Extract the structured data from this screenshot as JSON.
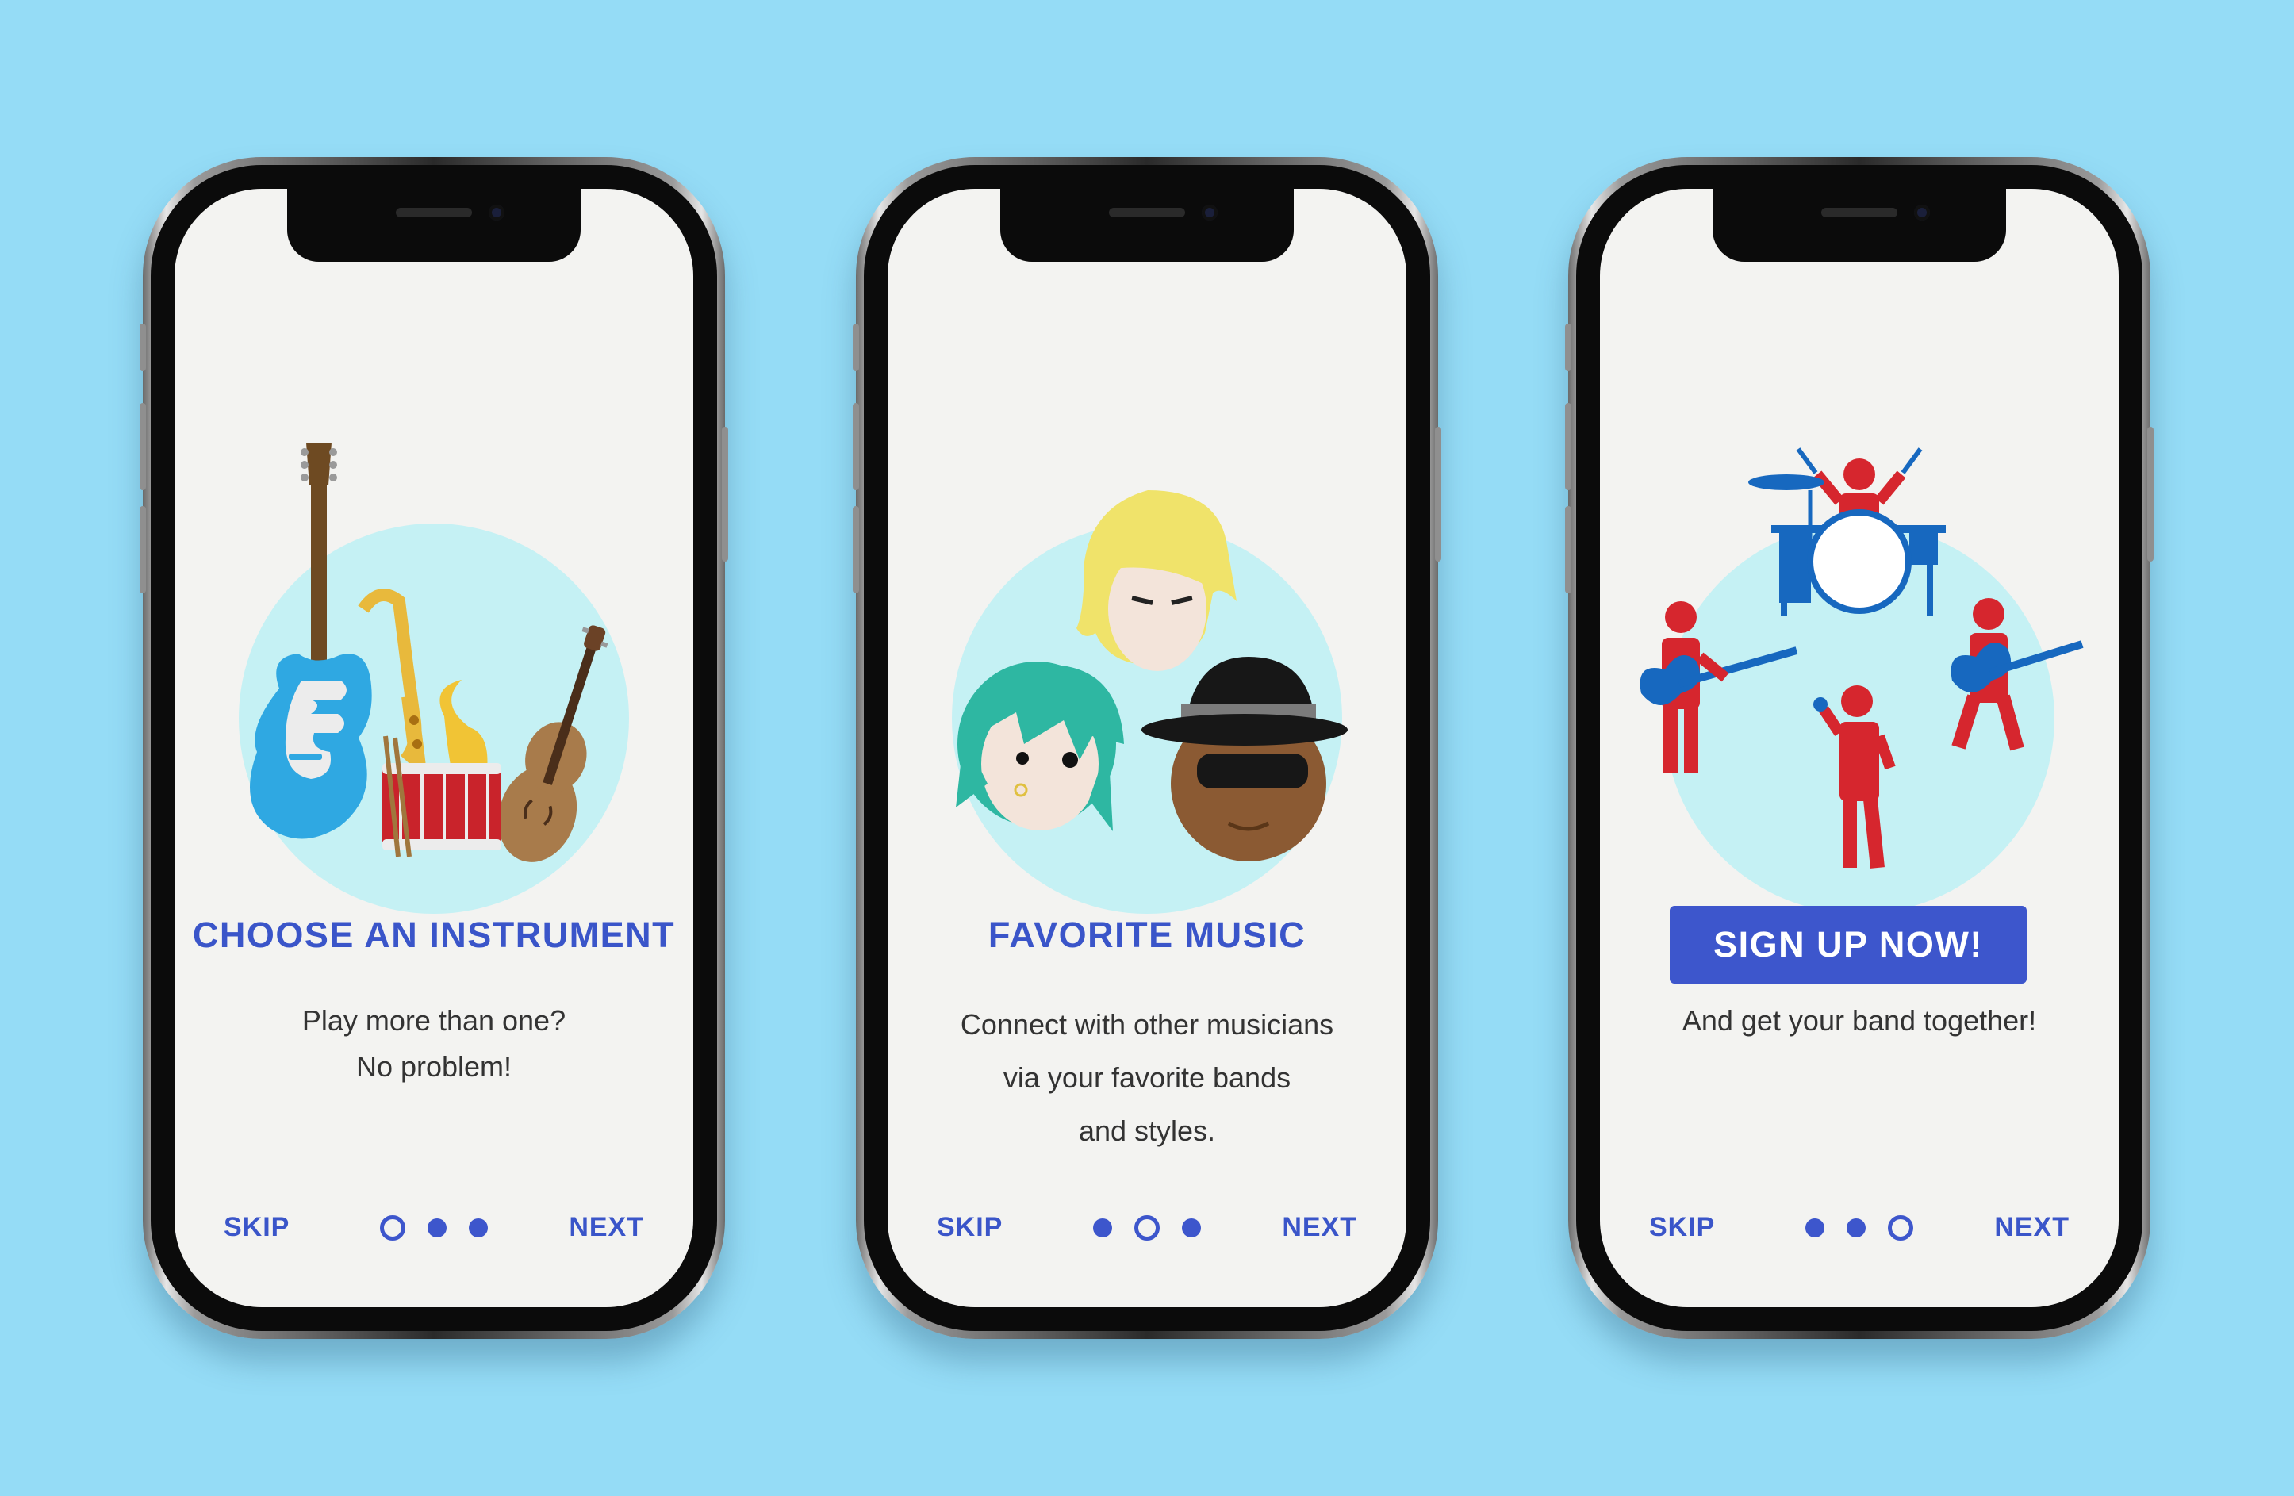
{
  "screens": [
    {
      "title": "CHOOSE AN INSTRUMENT",
      "body": [
        "Play more than one?",
        "No problem!"
      ],
      "skip": "SKIP",
      "next": "NEXT",
      "active_dot": 0,
      "illustration": "instruments-illustration"
    },
    {
      "title": "FAVORITE MUSIC",
      "body": [
        "Connect with other musicians",
        "via your favorite bands",
        "and styles."
      ],
      "skip": "SKIP",
      "next": "NEXT",
      "active_dot": 1,
      "illustration": "musicians-faces-illustration"
    },
    {
      "cta": "SIGN UP NOW!",
      "body": [
        "And get your band together!"
      ],
      "skip": "SKIP",
      "next": "NEXT",
      "active_dot": 2,
      "illustration": "band-illustration"
    }
  ],
  "colors": {
    "background": "#95dcf6",
    "accent": "#3d56cc",
    "circle": "#c5f1f4",
    "band_red": "#d6262e",
    "band_blue": "#1768bf"
  }
}
